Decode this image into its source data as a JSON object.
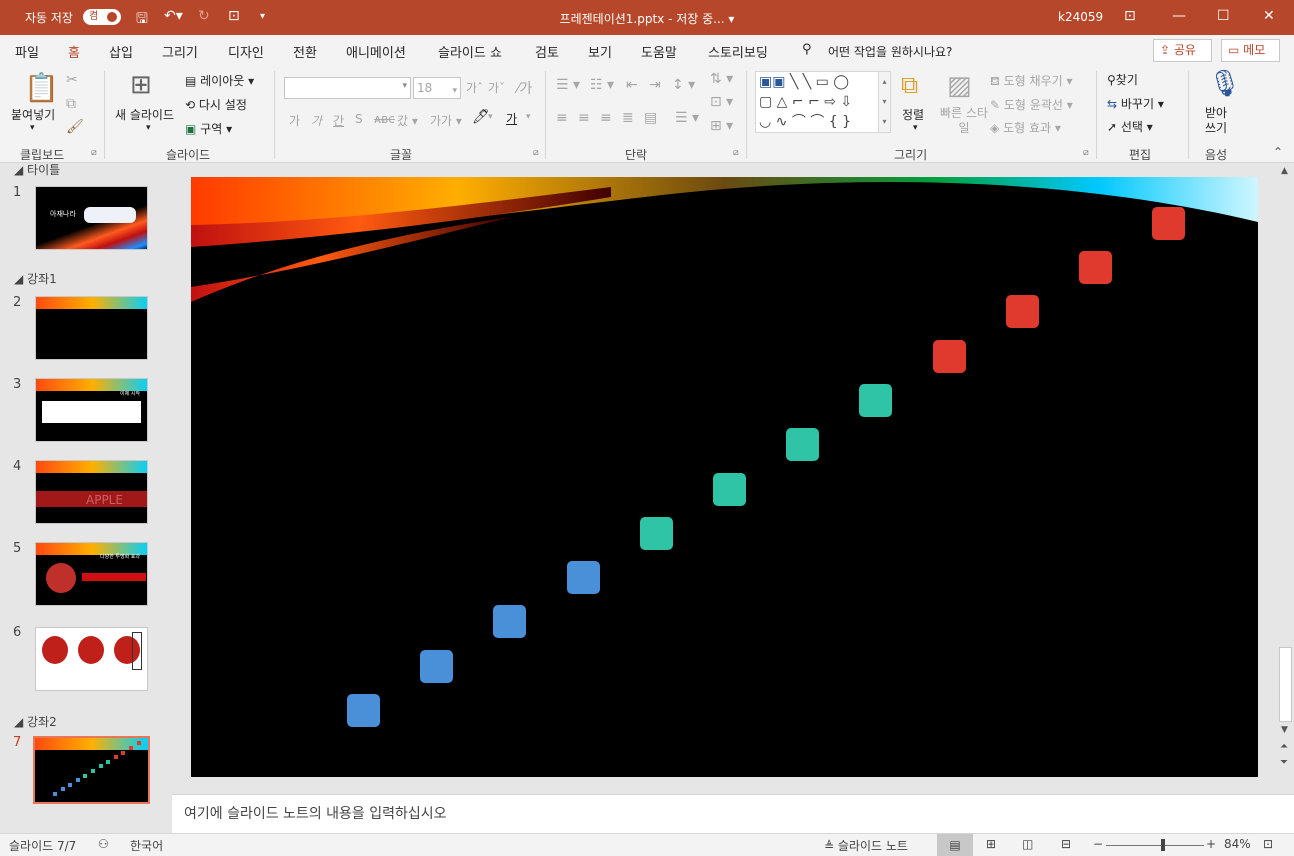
{
  "titlebar": {
    "autosave_label": "자동 저장",
    "autosave_state": "켬",
    "document_title": "프레젠테이션1.pptx - 저장 중... ▾",
    "user": "k24059"
  },
  "menu": {
    "tabs": [
      "파일",
      "홈",
      "삽입",
      "그리기",
      "디자인",
      "전환",
      "애니메이션",
      "슬라이드 쇼",
      "검토",
      "보기",
      "도움말",
      "스토리보딩"
    ],
    "active_tab": "홈",
    "search_placeholder": "어떤 작업을 원하시나요?",
    "share_label": "공유",
    "comment_label": "메모"
  },
  "ribbon": {
    "clipboard": {
      "paste": "붙여넣기",
      "group": "클립보드"
    },
    "slides": {
      "new_slide": "새 슬라이드",
      "layout": "레이아웃",
      "reset": "다시 설정",
      "section": "구역",
      "group": "슬라이드"
    },
    "font": {
      "size": "18",
      "group": "글꼴"
    },
    "paragraph": {
      "group": "단락"
    },
    "drawing": {
      "arrange": "정렬",
      "quick_styles": "빠른 스타일",
      "fill": "도형 채우기",
      "outline": "도형 윤곽선",
      "effects": "도형 효과",
      "group": "그리기"
    },
    "editing": {
      "find": "찾기",
      "replace": "바꾸기",
      "select": "선택",
      "group": "편집"
    },
    "voice": {
      "dictate": "받아 쓰기",
      "group": "음성"
    }
  },
  "slides_pane": {
    "sections": [
      "타이틀",
      "강좌1",
      "강좌2"
    ],
    "slides": [
      {
        "number": "1",
        "text": "아재나라"
      },
      {
        "number": "2",
        "text": ""
      },
      {
        "number": "3",
        "text": "이제 시작"
      },
      {
        "number": "4",
        "text": "APPLE"
      },
      {
        "number": "5",
        "text": "다양한 투명화 효과"
      },
      {
        "number": "6",
        "text": ""
      },
      {
        "number": "7",
        "text": ""
      }
    ],
    "current": "7"
  },
  "slide": {
    "squares": [
      {
        "color": "#4a90d9"
      },
      {
        "color": "#4a90d9"
      },
      {
        "color": "#4a90d9"
      },
      {
        "color": "#4a90d9"
      },
      {
        "color": "#2ec4a5"
      },
      {
        "color": "#2ec4a5"
      },
      {
        "color": "#2ec4a5"
      },
      {
        "color": "#2ec4a5"
      },
      {
        "color": "#e03a2f"
      },
      {
        "color": "#e03a2f"
      },
      {
        "color": "#e03a2f"
      },
      {
        "color": "#e03a2f"
      }
    ]
  },
  "notes": {
    "placeholder": "여기에 슬라이드 노트의 내용을 입력하십시오"
  },
  "status": {
    "slide_counter": "슬라이드 7/7",
    "language": "한국어",
    "notes_button": "슬라이드 노트",
    "zoom": "84%"
  },
  "colors": {
    "accent": "#b7472a",
    "selection": "#e8775a"
  }
}
